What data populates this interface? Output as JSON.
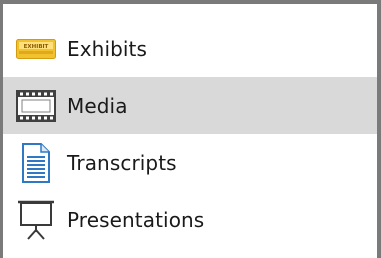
{
  "nav": {
    "items": [
      {
        "label": "Exhibits",
        "icon": "exhibit-sticker-icon",
        "selected": false
      },
      {
        "label": "Media",
        "icon": "film-strip-icon",
        "selected": true
      },
      {
        "label": "Transcripts",
        "icon": "document-icon",
        "selected": false
      },
      {
        "label": "Presentations",
        "icon": "projector-screen-icon",
        "selected": false
      }
    ],
    "exhibit_badge_text": "EXHIBIT"
  },
  "colors": {
    "selected_bg": "#d9d9d9",
    "frame_border": "#7a7a7a",
    "exhibit_yellow": "#f2c12e",
    "document_blue": "#2f78c4"
  }
}
